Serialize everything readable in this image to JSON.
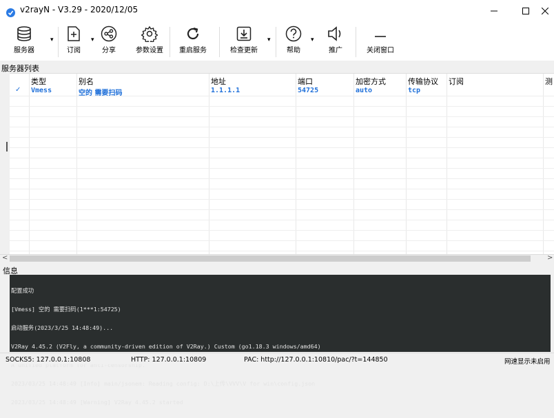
{
  "window": {
    "title": "v2rayN - V3.29 - 2020/12/05",
    "minimize_glyph": "—",
    "maximize_glyph": "☐",
    "close_glyph": "✕"
  },
  "toolbar": {
    "servers_label": "服务器",
    "subscribe_label": "订阅",
    "share_label": "分享",
    "settings_label": "参数设置",
    "restart_label": "重启服务",
    "update_label": "检查更新",
    "help_label": "帮助",
    "promote_label": "推广",
    "close_window_label": "关闭窗口",
    "caret": "▾"
  },
  "server_list": {
    "title": "服务器列表",
    "columns": [
      "类型",
      "别名",
      "地址",
      "端口",
      "加密方式",
      "传输协议",
      "订阅",
      "测"
    ],
    "rows": [
      {
        "check": "✓",
        "type": "Vmess",
        "alias": "空的 需要扫码",
        "address": "1.1.1.1",
        "port": "54725",
        "security": "auto",
        "network": "tcp",
        "subscription": ""
      }
    ]
  },
  "scrollbar": {
    "left_arrow": "<",
    "right_arrow": ">"
  },
  "info": {
    "title": "信息",
    "log": [
      "配置成功",
      "[Vmess] 空的 需要扫码(1***1:54725)",
      "启动服务(2023/3/25 14:48:49)...",
      "V2Ray 4.45.2 (V2Fly, a community-driven edition of V2Ray.) Custom (go1.18.3 windows/amd64)",
      "A unified platform for anti-censorship.",
      "2023/03/25 14:48:49 [Info] main/jsonem: Reading config: D:\\上传\\VVV\\V for win\\config.json",
      "2023/03/25 14:48:49 [Warning] V2Ray 4.45.2 started"
    ]
  },
  "status": {
    "socks": "SOCKS5:  127.0.0.1:10808",
    "http": "HTTP:  127.0.0.1:10809",
    "pac": "PAC:  http://127.0.0.1:10810/pac/?t=144850",
    "speed": "网速显示未启用"
  },
  "colors": {
    "accent": "#1e6fd9",
    "log_bg": "#2a2e2e",
    "log_text": "#e4e4e4"
  }
}
